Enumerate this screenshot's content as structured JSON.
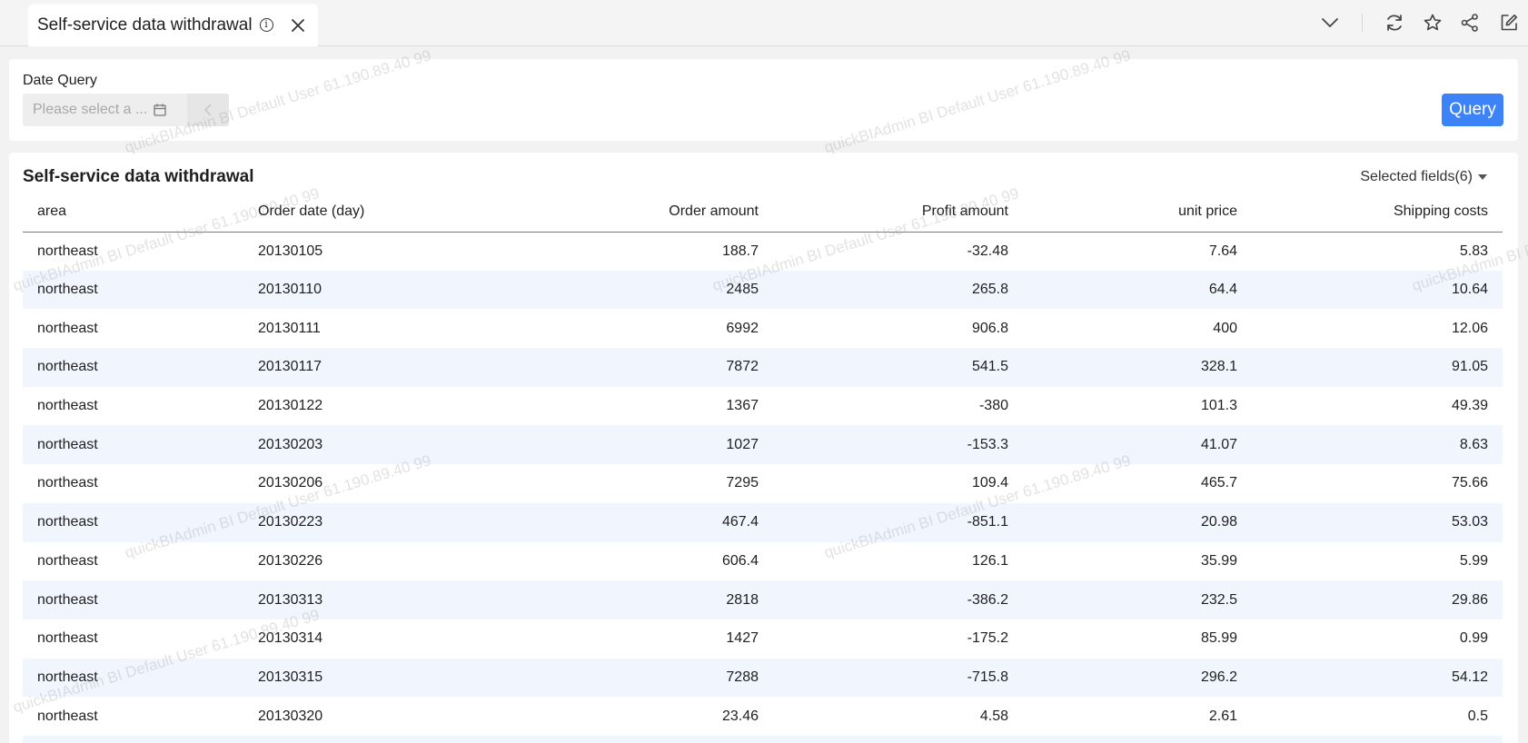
{
  "tab": {
    "title": "Self-service data withdrawal"
  },
  "top_actions": [
    "chevron-down-icon",
    "refresh-icon",
    "star-icon",
    "share-icon",
    "edit-icon"
  ],
  "query": {
    "label": "Date Query",
    "date_placeholder": "Please select a ...",
    "query_button": "Query"
  },
  "table": {
    "title": "Self-service data withdrawal",
    "selected_fields": "Selected fields(6)",
    "columns": [
      "area",
      "Order date (day)",
      "Order amount",
      "Profit amount",
      "unit price",
      "Shipping costs"
    ],
    "rows": [
      [
        "northeast",
        "20130105",
        "188.7",
        "-32.48",
        "7.64",
        "5.83"
      ],
      [
        "northeast",
        "20130110",
        "2485",
        "265.8",
        "64.4",
        "10.64"
      ],
      [
        "northeast",
        "20130111",
        "6992",
        "906.8",
        "400",
        "12.06"
      ],
      [
        "northeast",
        "20130117",
        "7872",
        "541.5",
        "328.1",
        "91.05"
      ],
      [
        "northeast",
        "20130122",
        "1367",
        "-380",
        "101.3",
        "49.39"
      ],
      [
        "northeast",
        "20130203",
        "1027",
        "-153.3",
        "41.07",
        "8.63"
      ],
      [
        "northeast",
        "20130206",
        "7295",
        "109.4",
        "465.7",
        "75.66"
      ],
      [
        "northeast",
        "20130223",
        "467.4",
        "-851.1",
        "20.98",
        "53.03"
      ],
      [
        "northeast",
        "20130226",
        "606.4",
        "126.1",
        "35.99",
        "5.99"
      ],
      [
        "northeast",
        "20130313",
        "2818",
        "-386.2",
        "232.5",
        "29.86"
      ],
      [
        "northeast",
        "20130314",
        "1427",
        "-175.2",
        "85.99",
        "0.99"
      ],
      [
        "northeast",
        "20130315",
        "7288",
        "-715.8",
        "296.2",
        "54.12"
      ],
      [
        "northeast",
        "20130320",
        "23.46",
        "4.58",
        "2.61",
        "0.5"
      ]
    ]
  },
  "watermarks": [
    "quickBIAdmin BI Default User 61.190.89.40 99",
    "quickBIAdmin BI Default User 61.190.89.40 99",
    "quickBIAdmin BI Default User 61.190.89.40 99",
    "quickBIAdmin BI Default User 61.190.89.40 99",
    "quickBIAdmin BI Default User 61.190.89.40 99",
    "quickBIAdmin BI Default User 61.190.89.40 99",
    "quickBIAdmin BI Default User 61.190.89.40 99",
    "quickBIAdmin BI Default User 61.190.89.40 99"
  ]
}
